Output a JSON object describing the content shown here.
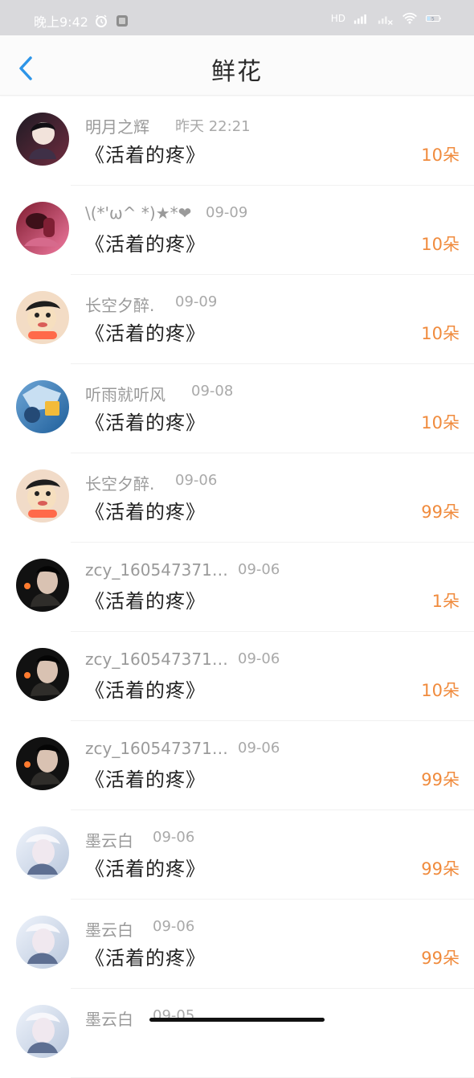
{
  "status_bar": {
    "time": "晚上9:42",
    "hd_text": "HD",
    "battery_level": "5",
    "icons": [
      "alarm-icon",
      "app-icon",
      "signal-icon",
      "signal-off-icon",
      "wifi-icon",
      "battery-icon"
    ]
  },
  "header": {
    "title": "鲜花"
  },
  "items": [
    {
      "name": "明月之辉",
      "time": "昨天 22:21",
      "work": "《活着的疼》",
      "count": "10朵"
    },
    {
      "name": "\\(*'ω^ *)★*❤",
      "time": "09-09",
      "work": "《活着的疼》",
      "count": "10朵"
    },
    {
      "name": "长空夕醉.",
      "time": "09-09",
      "work": "《活着的疼》",
      "count": "10朵"
    },
    {
      "name": "听雨就听风",
      "time": "09-08",
      "work": "《活着的疼》",
      "count": "10朵"
    },
    {
      "name": "长空夕醉.",
      "time": "09-06",
      "work": "《活着的疼》",
      "count": "99朵"
    },
    {
      "name": "zcy_160547371…",
      "time": "09-06",
      "work": "《活着的疼》",
      "count": "1朵"
    },
    {
      "name": "zcy_160547371…",
      "time": "09-06",
      "work": "《活着的疼》",
      "count": "10朵"
    },
    {
      "name": "zcy_160547371…",
      "time": "09-06",
      "work": "《活着的疼》",
      "count": "99朵"
    },
    {
      "name": "墨云白",
      "time": "09-06",
      "work": "《活着的疼》",
      "count": "99朵"
    },
    {
      "name": "墨云白",
      "time": "09-06",
      "work": "《活着的疼》",
      "count": "99朵"
    },
    {
      "name": "墨云白",
      "time": "09-05",
      "work": "",
      "count": ""
    }
  ]
}
